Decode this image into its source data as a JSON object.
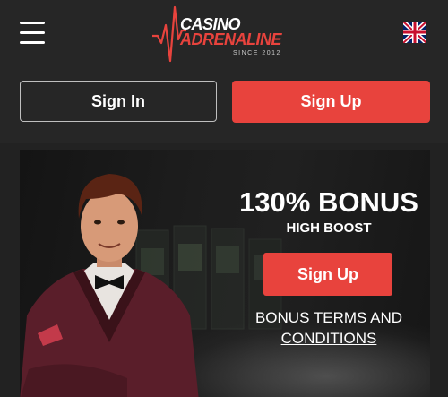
{
  "header": {
    "logo_line1": "CASINO",
    "logo_line2": "ADRENALINE",
    "logo_since": "SINCE 2012",
    "menu_icon": "hamburger-menu-icon",
    "language_icon": "uk-flag-icon"
  },
  "auth": {
    "signin_label": "Sign In",
    "signup_label": "Sign Up"
  },
  "banner": {
    "title": "130% BONUS",
    "subtitle": "HIGH BOOST",
    "signup_label": "Sign Up",
    "terms_link": "BONUS TERMS AND CONDITIONS"
  },
  "colors": {
    "accent": "#e8433d",
    "background": "#222222",
    "header": "#262626"
  }
}
